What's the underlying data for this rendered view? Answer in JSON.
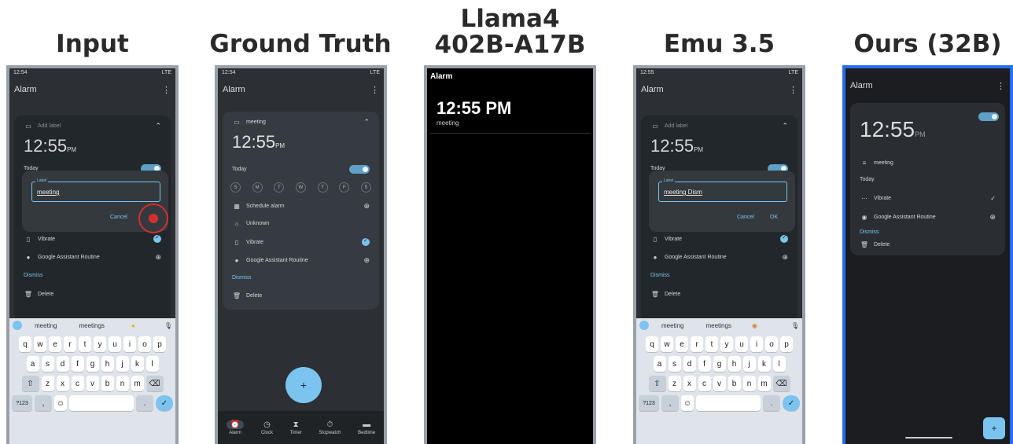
{
  "titles": {
    "input": "Input",
    "ground_truth": "Ground Truth",
    "llama_line1": "Llama4",
    "llama_line2": "402B-A17B",
    "emu": "Emu 3.5",
    "ours": "Ours (32B)"
  },
  "input": {
    "status_time": "12:54",
    "status_right": "LTE",
    "app_title": "Alarm",
    "add_label": "Add label",
    "time": "12:55",
    "ampm": "PM",
    "day": "Today",
    "dialog_label": "Label",
    "dialog_value": "meeting",
    "cancel": "Cancel",
    "vibrate": "Vibrate",
    "assistant": "Google Assistant Routine",
    "dismiss": "Dismiss",
    "delete": "Delete",
    "suggestions": [
      "meeting",
      "meetings"
    ],
    "row1": [
      "q",
      "w",
      "e",
      "r",
      "t",
      "y",
      "u",
      "i",
      "o",
      "p"
    ],
    "row2": [
      "a",
      "s",
      "d",
      "f",
      "g",
      "h",
      "j",
      "k",
      "l"
    ],
    "row3": [
      "z",
      "x",
      "c",
      "v",
      "b",
      "n",
      "m"
    ],
    "sym": "?123"
  },
  "ground_truth": {
    "status_time": "12:54",
    "status_right": "LTE",
    "app_title": "Alarm",
    "label": "meeting",
    "time": "12:55",
    "ampm": "PM",
    "day": "Today",
    "days": [
      "S",
      "M",
      "T",
      "W",
      "T",
      "F",
      "S"
    ],
    "schedule": "Schedule alarm",
    "unknown": "Unknown",
    "vibrate": "Vibrate",
    "assistant": "Google Assistant Routine",
    "dismiss": "Dismiss",
    "delete": "Delete",
    "fab": "+",
    "nav": [
      "Alarm",
      "Clock",
      "Timer",
      "Stopwatch",
      "Bedtime"
    ]
  },
  "llama": {
    "app_title": "Alarm",
    "time": "12:55 PM",
    "label": "meeting"
  },
  "emu": {
    "status_time": "12:55",
    "status_right": "LTE",
    "app_title": "Alarm",
    "add_label": "Add label",
    "time": "12:55",
    "ampm": "PM",
    "day": "Today",
    "dialog_label": "Label",
    "dialog_value": "meeting Dism",
    "cancel": "Cancel",
    "ok": "OK",
    "vibrate": "Vibrate",
    "assistant": "Google Assistant Routine",
    "dismiss": "Dismiss",
    "delete": "Delete",
    "suggestions": [
      "meeting",
      "meetings"
    ],
    "sym": "?123"
  },
  "ours": {
    "app_title": "Alarm",
    "time": "12:55",
    "ampm": "PM",
    "label": "meeting",
    "day": "Today",
    "vibrate": "Vibrate",
    "assistant": "Google Assistant Routine",
    "dismiss": "Dismiss",
    "delete": "Delete",
    "fab": "+"
  },
  "colors": {
    "accent": "#7cc4f0",
    "ours_border": "#2a6cf2",
    "frame": "#9aa0aa",
    "highlight": "#d32f2f"
  }
}
